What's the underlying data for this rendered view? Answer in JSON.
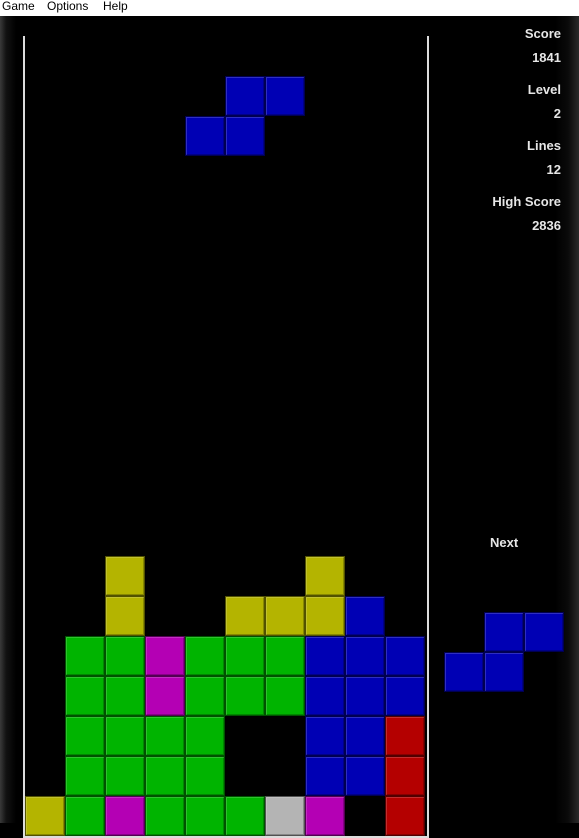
{
  "menu": {
    "items": [
      {
        "label": "Game"
      },
      {
        "label": "Options"
      },
      {
        "label": "Help"
      }
    ]
  },
  "stats": {
    "score_label": "Score",
    "score": "1841",
    "level_label": "Level",
    "level": "2",
    "lines_label": "Lines",
    "lines": "12",
    "high_score_label": "High Score",
    "high_score": "2836"
  },
  "next": {
    "label": "Next",
    "piece": "S",
    "color": "blue"
  },
  "colors": {
    "blue": "#0000b4",
    "green": "#00b400",
    "yellow": "#b4b400",
    "magenta": "#b400b4",
    "red": "#b40000",
    "gray": "#b4b4b4"
  },
  "board": {
    "columns": 10,
    "rows": 20,
    "active_piece": {
      "shape": "S",
      "color": "blue",
      "cells": [
        [
          5,
          1
        ],
        [
          6,
          1
        ],
        [
          4,
          2
        ],
        [
          5,
          2
        ]
      ]
    },
    "settled": [
      "..........",
      "..........",
      "..........",
      "..........",
      "..........",
      "..........",
      "..........",
      "..........",
      "..........",
      "..........",
      "..........",
      "..........",
      "..........",
      "..Y....Y..",
      "..Y..YYYB.",
      ".GGMGGGBBB",
      ".GGMGGGBBB",
      ".GGGG..BBR",
      ".GGGG..BBR",
      "YGMGGGAM.R"
    ],
    "legend": {
      "Y": "yellow",
      "G": "green",
      "M": "magenta",
      "B": "blue",
      "R": "red",
      "A": "gray"
    }
  }
}
